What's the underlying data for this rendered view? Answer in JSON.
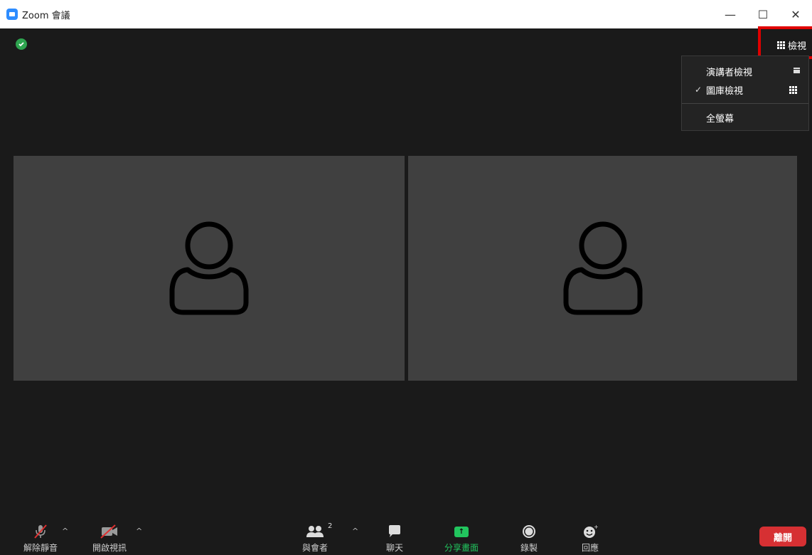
{
  "window": {
    "title": "Zoom 會議",
    "controls": {
      "minimize": "—",
      "maximize": "☐",
      "close": "✕"
    }
  },
  "view_button": {
    "label": "檢視"
  },
  "view_menu": {
    "items": [
      {
        "label": "演講者檢視",
        "checked": false,
        "icon": "speaker-view-icon"
      },
      {
        "label": "圖庫檢視",
        "checked": true,
        "check_mark": "✓",
        "icon": "gallery-view-icon"
      },
      {
        "label": "全螢幕",
        "checked": false
      }
    ]
  },
  "participants_tiles": [
    {
      "icon": "avatar-placeholder-icon"
    },
    {
      "icon": "avatar-placeholder-icon"
    }
  ],
  "toolbar": {
    "unmute": "解除靜音",
    "start_video": "開啟視訊",
    "participants": "與會者",
    "participants_count": "2",
    "chat": "聊天",
    "share_screen": "分享畫面",
    "record": "錄製",
    "reactions": "回應",
    "leave": "離開",
    "caret": "^"
  },
  "colors": {
    "background": "#1a1a1a",
    "tile": "#404040",
    "share_green": "#22c55e",
    "leave_red": "#d63033",
    "highlight_red": "#e00000",
    "shield_green": "#2ea44f",
    "zoom_blue": "#2d8cff"
  }
}
